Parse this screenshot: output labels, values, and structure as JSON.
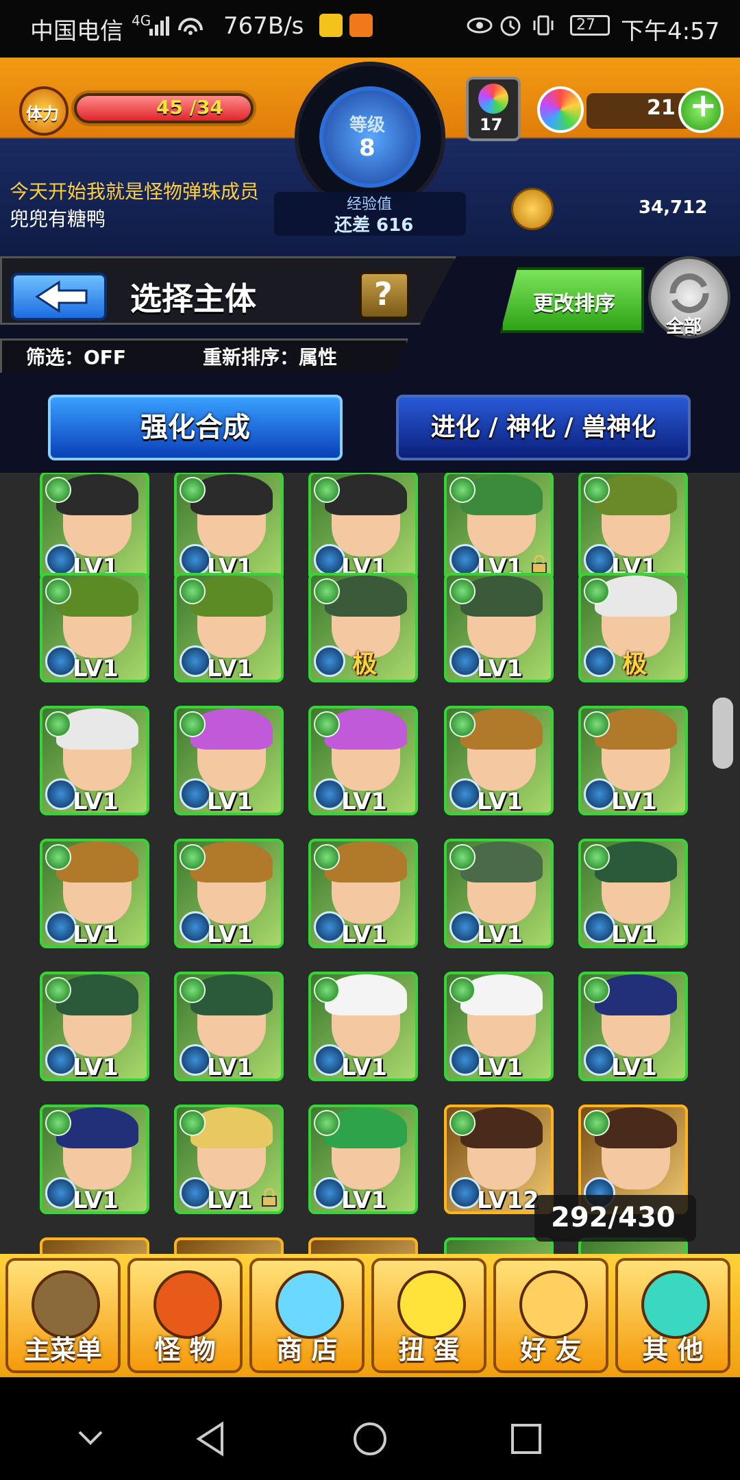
{
  "status_bar": {
    "carrier": "中国电信",
    "network": "4G",
    "speed": "767B/s",
    "battery": "27",
    "time": "下午4:57"
  },
  "hud": {
    "stamina_label": "体力",
    "stamina_text": "45 /34",
    "level_label": "等级",
    "level_value": "8",
    "exp_label": "经验值",
    "exp_remaining": "还差 616",
    "item_count": "17",
    "orb_count": "21",
    "coin_count": "34,712",
    "message": "今天开始我就是怪物弹珠成员",
    "username": "兜兜有糖鸭"
  },
  "header": {
    "back_icon": "back-arrow-icon",
    "title": "选择主体",
    "help_label": "?",
    "filter_label": "筛选：OFF",
    "sort_label": "重新排序：属性",
    "change_order_label": "更改排序",
    "all_label": "全部"
  },
  "tabs": [
    {
      "label": "强化合成",
      "active": true
    },
    {
      "label": "进化 / 神化 / 兽神化",
      "active": false
    }
  ],
  "grid": {
    "count_label": "292/430",
    "rows": [
      [
        {
          "lv": "LV1",
          "hair": "#2b2b2b",
          "gold": false
        },
        {
          "lv": "LV1",
          "hair": "#2b2b2b",
          "gold": false
        },
        {
          "lv": "LV1",
          "hair": "#2b2b2b",
          "gold": false
        },
        {
          "lv": "LV1",
          "hair": "#3c8a3c",
          "gold": false,
          "lock": true
        },
        {
          "lv": "LV1",
          "hair": "#6a8a2a",
          "gold": false
        }
      ],
      [
        {
          "lv": "LV1",
          "hair": "#5c8a24",
          "gold": false
        },
        {
          "lv": "LV1",
          "hair": "#5c8a24",
          "gold": false
        },
        {
          "lv": "",
          "hair": "#3a5a3a",
          "gold": false,
          "badge": "极"
        },
        {
          "lv": "LV1",
          "hair": "#3a5a3a",
          "gold": false
        },
        {
          "lv": "",
          "hair": "#e8e8e8",
          "gold": false,
          "badge": "极"
        }
      ],
      [
        {
          "lv": "LV1",
          "hair": "#e8e8e8",
          "gold": false
        },
        {
          "lv": "LV1",
          "hair": "#c05ad8",
          "gold": false
        },
        {
          "lv": "LV1",
          "hair": "#c05ad8",
          "gold": false
        },
        {
          "lv": "LV1",
          "hair": "#b07a2a",
          "gold": false
        },
        {
          "lv": "LV1",
          "hair": "#b07a2a",
          "gold": false
        }
      ],
      [
        {
          "lv": "LV1",
          "hair": "#b07a2a",
          "gold": false
        },
        {
          "lv": "LV1",
          "hair": "#b07a2a",
          "gold": false
        },
        {
          "lv": "LV1",
          "hair": "#b07a2a",
          "gold": false
        },
        {
          "lv": "LV1",
          "hair": "#4a6a4a",
          "gold": false
        },
        {
          "lv": "LV1",
          "hair": "#2a5a3a",
          "gold": false
        }
      ],
      [
        {
          "lv": "LV1",
          "hair": "#2a5a3a",
          "gold": false
        },
        {
          "lv": "LV1",
          "hair": "#2a5a3a",
          "gold": false
        },
        {
          "lv": "LV1",
          "hair": "#f4f4f4",
          "gold": false
        },
        {
          "lv": "LV1",
          "hair": "#f4f4f4",
          "gold": false
        },
        {
          "lv": "LV1",
          "hair": "#22307a",
          "gold": false
        }
      ],
      [
        {
          "lv": "LV1",
          "hair": "#22307a",
          "gold": false
        },
        {
          "lv": "LV1",
          "hair": "#e8c860",
          "gold": false,
          "lock": true
        },
        {
          "lv": "LV1",
          "hair": "#2ea34a",
          "gold": false
        },
        {
          "lv": "LV12",
          "hair": "#4a2a1a",
          "gold": true
        },
        {
          "lv": "",
          "hair": "#4a2a1a",
          "gold": true
        }
      ]
    ]
  },
  "nav": [
    {
      "label": "主菜单",
      "icon": "castle-gate-icon"
    },
    {
      "label": "怪 物",
      "icon": "dragon-icon"
    },
    {
      "label": "商 店",
      "icon": "rainbow-orb-icon"
    },
    {
      "label": "扭 蛋",
      "icon": "egg-icon"
    },
    {
      "label": "好 友",
      "icon": "balloons-icon"
    },
    {
      "label": "其 他",
      "icon": "question-diamond-icon"
    }
  ]
}
